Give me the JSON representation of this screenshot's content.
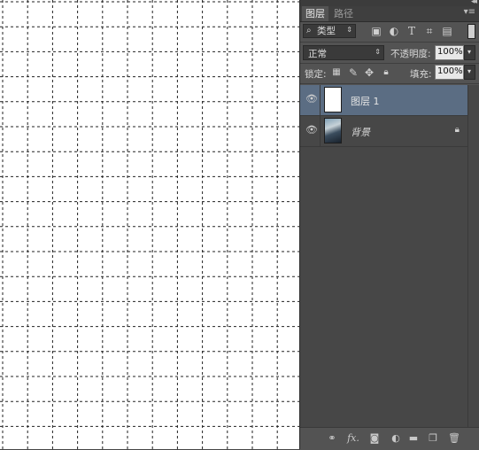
{
  "tabs": {
    "layers": "图层",
    "paths": "路径"
  },
  "filter": {
    "kind_label": "类型",
    "search_icon": "⌕"
  },
  "blend": {
    "mode": "正常",
    "opacity_label": "不透明度:",
    "opacity_value": "100%"
  },
  "locks": {
    "label": "锁定:",
    "fill_label": "填充:",
    "fill_value": "100%"
  },
  "layers": [
    {
      "name": "图层 1",
      "selected": true
    },
    {
      "name": "背景",
      "selected": false,
      "locked": true
    }
  ],
  "grid": {
    "line_color": "#222222",
    "dash": "dashed"
  }
}
